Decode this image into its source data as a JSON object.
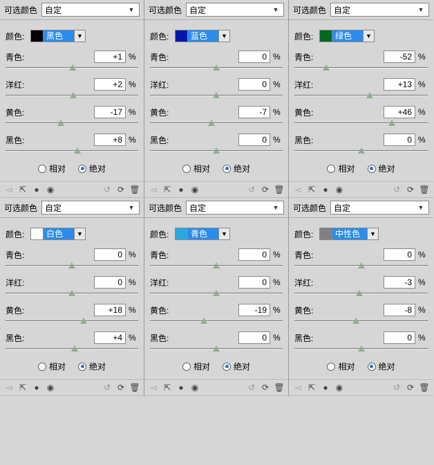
{
  "labels": {
    "selectable": "可选颜色",
    "custom": "自定",
    "colorLabel": "颜色:",
    "cyan": "青色:",
    "magenta": "洋红:",
    "yellow": "黄色:",
    "black": "黑色:",
    "pct": "%",
    "relative": "相对",
    "absolute": "绝对"
  },
  "panels": [
    {
      "colorName": "黑色",
      "swatch": "#000000",
      "c": "+1",
      "m": "+2",
      "y": "-17",
      "k": "+8",
      "mode": "absolute"
    },
    {
      "colorName": "蓝色",
      "swatch": "#0018a8",
      "c": "0",
      "m": "0",
      "y": "-7",
      "k": "0",
      "mode": "absolute"
    },
    {
      "colorName": "绿色",
      "swatch": "#006b1f",
      "c": "-52",
      "m": "+13",
      "y": "+46",
      "k": "0",
      "mode": "absolute"
    },
    {
      "colorName": "白色",
      "swatch": "#ffffff",
      "c": "0",
      "m": "0",
      "y": "+18",
      "k": "+4",
      "mode": "absolute"
    },
    {
      "colorName": "青色",
      "swatch": "#2aa9e0",
      "c": "0",
      "m": "0",
      "y": "-19",
      "k": "0",
      "mode": "absolute"
    },
    {
      "colorName": "中性色",
      "swatch": "#808080",
      "c": "0",
      "m": "-3",
      "y": "-8",
      "k": "0",
      "mode": "absolute"
    }
  ]
}
